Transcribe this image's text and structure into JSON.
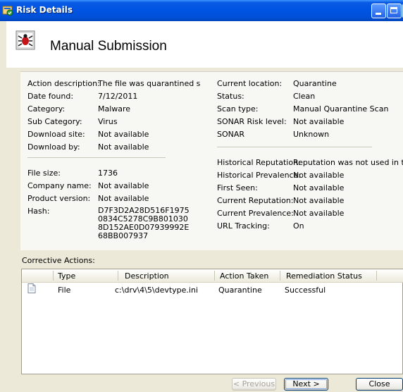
{
  "window": {
    "title": "Risk Details"
  },
  "header": {
    "title": "Manual Submission"
  },
  "details": {
    "left": [
      {
        "label": "Action description:",
        "value": "The file was quarantined successfully"
      },
      {
        "label": "Date found:",
        "value": "7/12/2011"
      },
      {
        "label": "Category:",
        "value": "Malware"
      },
      {
        "label": "Sub Category:",
        "value": "Virus"
      },
      {
        "label": "Download site:",
        "value": "Not available"
      },
      {
        "label": "Download by:",
        "value": "Not available"
      }
    ],
    "left2": [
      {
        "label": "File size:",
        "value": "1736"
      },
      {
        "label": "Company name:",
        "value": "Not available"
      },
      {
        "label": "Product version:",
        "value": "Not available"
      }
    ],
    "hash": {
      "label": "Hash:",
      "value": "D7F3D2A28D516F19750834C5278C9B8010308D152AE0D07939992E68BB007937"
    },
    "right": [
      {
        "label": "Current location:",
        "value": "Quarantine"
      },
      {
        "label": "Status:",
        "value": "Clean"
      },
      {
        "label": "Scan type:",
        "value": "Manual Quarantine Scan"
      },
      {
        "label": "SONAR Risk level:",
        "value": "Not available"
      },
      {
        "label": "SONAR",
        "value": "Unknown"
      }
    ],
    "right2": [
      {
        "label": "Historical Reputation:",
        "value": "Reputation was not used in this detection"
      },
      {
        "label": "Historical Prevalence:",
        "value": "Not available"
      },
      {
        "label": "First Seen:",
        "value": "Not available"
      },
      {
        "label": "Current Reputation:",
        "value": "Not available"
      },
      {
        "label": "Current Prevalence:",
        "value": "Not available"
      },
      {
        "label": "URL Tracking:",
        "value": "On"
      }
    ]
  },
  "corrective": {
    "label": "Corrective Actions:",
    "columns": [
      "Type",
      "Description",
      "Action Taken",
      "Remediation Status"
    ],
    "rows": [
      {
        "type": "File",
        "description": "c:\\drv\\4\\5\\devtype.ini",
        "action": "Quarantine",
        "status": "Successful"
      }
    ]
  },
  "buttons": {
    "previous": "< Previous",
    "next": "Next >",
    "close": "Close"
  }
}
